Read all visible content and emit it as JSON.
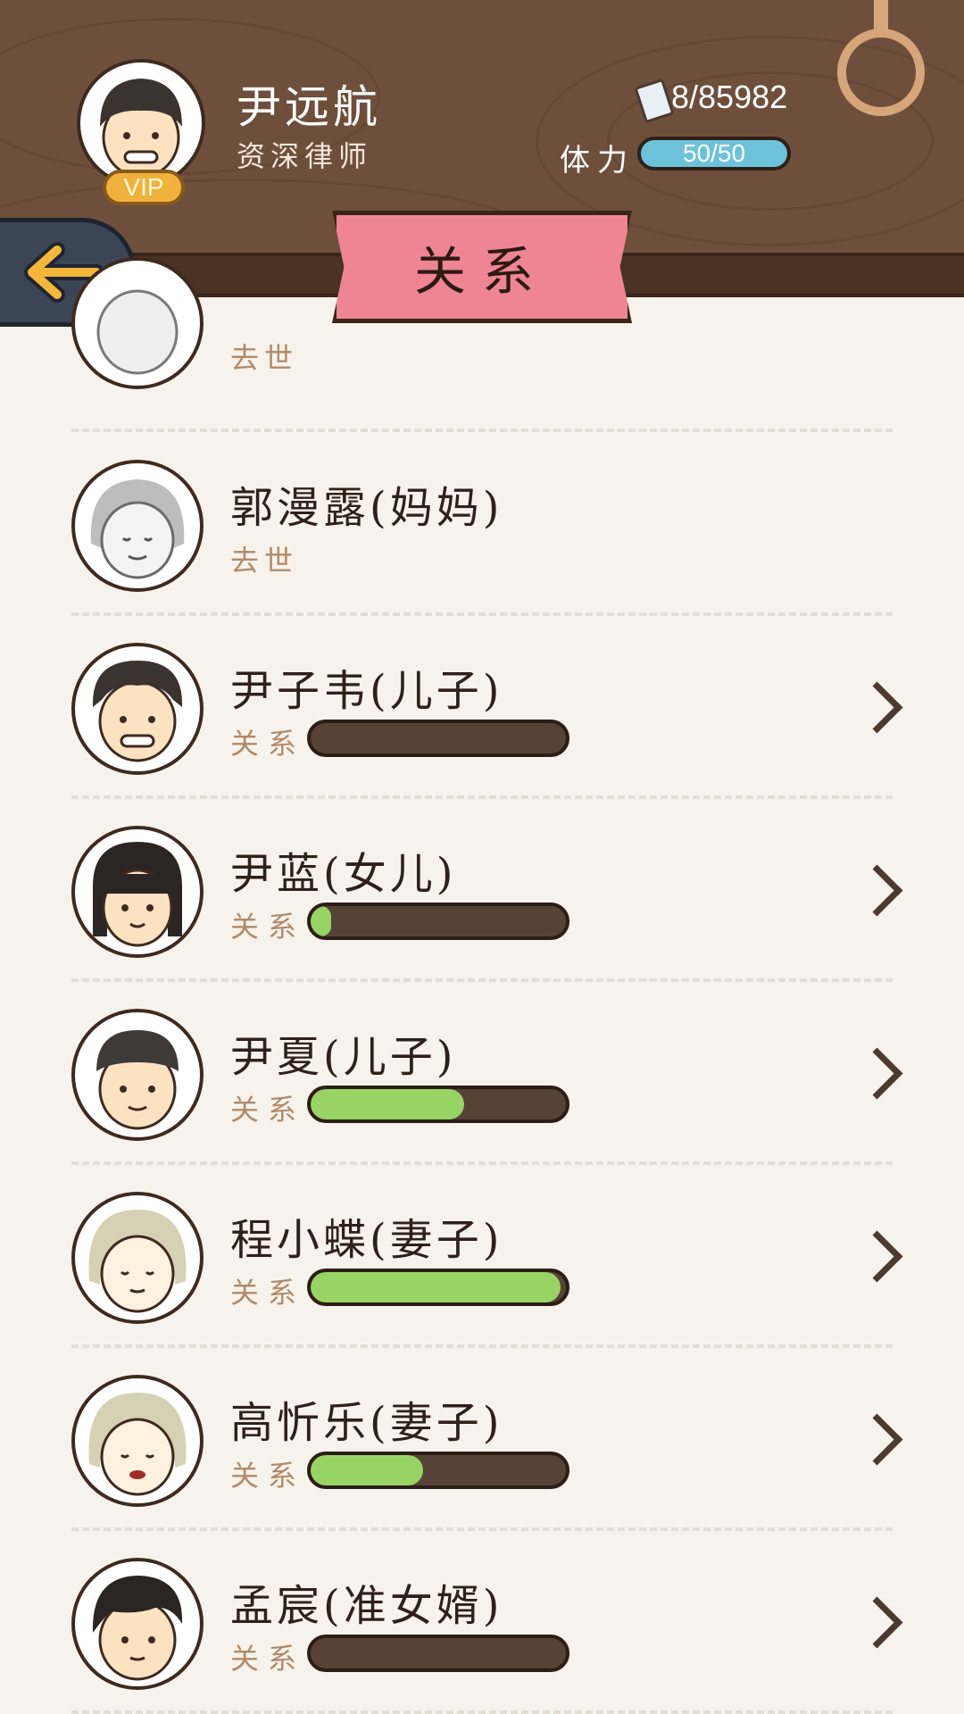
{
  "header": {
    "player_name": "尹远航",
    "player_title": "资深律师",
    "vip_label": "VIP",
    "money": "8/85982",
    "stamina_label": "体力",
    "stamina_value": "50/50",
    "page_title": "关系"
  },
  "relations": [
    {
      "name": "",
      "status": "去世",
      "deceased": true,
      "avatar": "elder-man-avatar"
    },
    {
      "name": "郭漫露(妈妈)",
      "status": "去世",
      "deceased": true,
      "avatar": "elder-woman-avatar"
    },
    {
      "name": "尹子韦(儿子)",
      "rel_label": "关系",
      "level": 0.0,
      "avatar": "young-man-avatar"
    },
    {
      "name": "尹蓝(女儿)",
      "rel_label": "关系",
      "level": 0.08,
      "avatar": "girl-avatar"
    },
    {
      "name": "尹夏(儿子)",
      "rel_label": "关系",
      "level": 0.6,
      "avatar": "boy-avatar"
    },
    {
      "name": "程小蝶(妻子)",
      "rel_label": "关系",
      "level": 0.98,
      "avatar": "old-woman-avatar"
    },
    {
      "name": "高忻乐(妻子)",
      "rel_label": "关系",
      "level": 0.44,
      "avatar": "old-woman-lipstick-avatar"
    },
    {
      "name": "孟宸(准女婿)",
      "rel_label": "关系",
      "level": 0.0,
      "avatar": "man-avatar"
    }
  ],
  "colors": {
    "header_bg": "#6e4f3c",
    "banner": "#ef8592",
    "bar_fill": "#98d464",
    "bar_track": "#564236",
    "stamina": "#6cc3d9",
    "list_bg": "#f7f3ec"
  }
}
